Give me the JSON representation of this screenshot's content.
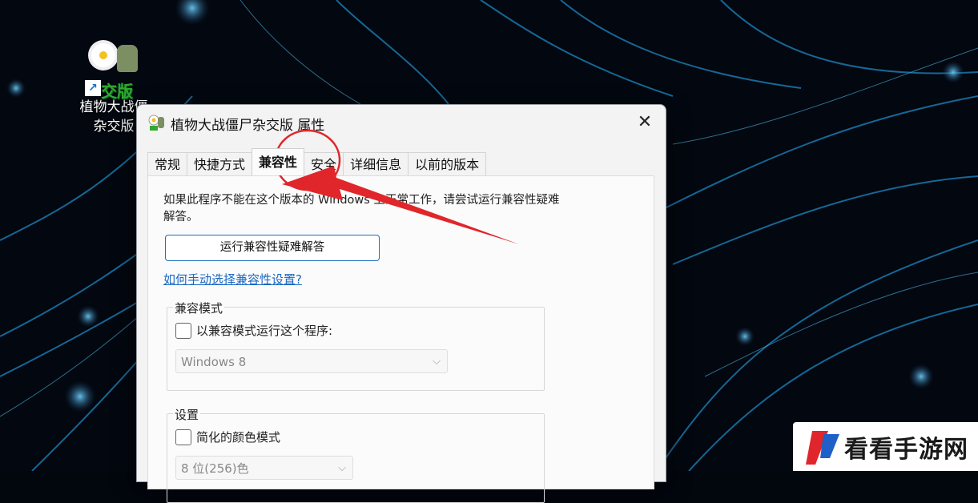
{
  "desktop": {
    "shortcut": {
      "label_line1": "植物大战僵",
      "label_line2": "杂交版",
      "icon_badge": "交版"
    }
  },
  "dialog": {
    "title": "植物大战僵尸杂交版 属性",
    "close_label": "✕",
    "tabs": [
      {
        "label": "常规"
      },
      {
        "label": "快捷方式"
      },
      {
        "label": "兼容性",
        "active": true
      },
      {
        "label": "安全"
      },
      {
        "label": "详细信息"
      },
      {
        "label": "以前的版本"
      }
    ],
    "compat": {
      "intro": "如果此程序不能在这个版本的 Windows 上正常工作，请尝试运行兼容性疑难解答。",
      "run_button": "运行兼容性疑难解答",
      "help_link": "如何手动选择兼容性设置?",
      "mode_group": {
        "legend": "兼容模式",
        "checkbox_label": "以兼容模式运行这个程序:",
        "selected_os": "Windows 8"
      },
      "settings_group": {
        "legend": "设置",
        "checkbox_label": "简化的颜色模式",
        "selected_color": "8 位(256)色"
      }
    }
  },
  "watermark": {
    "text": "看看手游网"
  },
  "colors": {
    "annotation": "#e0262a",
    "link": "#1a67c1",
    "button_border": "#1f6fb8"
  }
}
